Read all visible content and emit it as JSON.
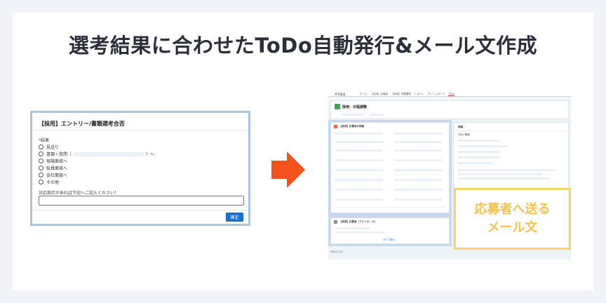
{
  "page": {
    "title": "選考結果に合わせたToDo自動発行&メール文作成"
  },
  "form": {
    "title": "【採用】エントリー/書類選考合否",
    "question_label": "結果",
    "required_mark": "*",
    "options": [
      "見送り",
      "書類＋質問（",
      "現場面接へ",
      "役員面接へ",
      "会社面接へ",
      "その他"
    ],
    "option_suffix": "）へ",
    "hint": "対応指示があれば下記へご記入ください！",
    "confirm_label": "確定"
  },
  "colors": {
    "arrow": "#f4511e",
    "highlight_border": "#f7d36a",
    "highlight_text": "#f3c34d",
    "form_border": "#a9c3dd",
    "button": "#1b6fd1"
  },
  "crm": {
    "app_name": "ATS採用",
    "tabs": [
      "ホーム",
      "【採用】応募者",
      "【採用】書類選考",
      "レポート",
      "ダッシュボード",
      "ToDo"
    ],
    "active_tab_index": 5,
    "record_title": "採用：日程調整",
    "left_card_title": "【採用】応募者の詳細",
    "left_card2_title": "【採用】応募者（ファイル）(1)",
    "left_card2_footer": "すべて表示",
    "right_card_title": "詳細",
    "right_section": "ToDo 情報",
    "footer": "ToDoリスト"
  },
  "highlight": {
    "line1": "応募者へ送る",
    "line2": "メール文"
  }
}
